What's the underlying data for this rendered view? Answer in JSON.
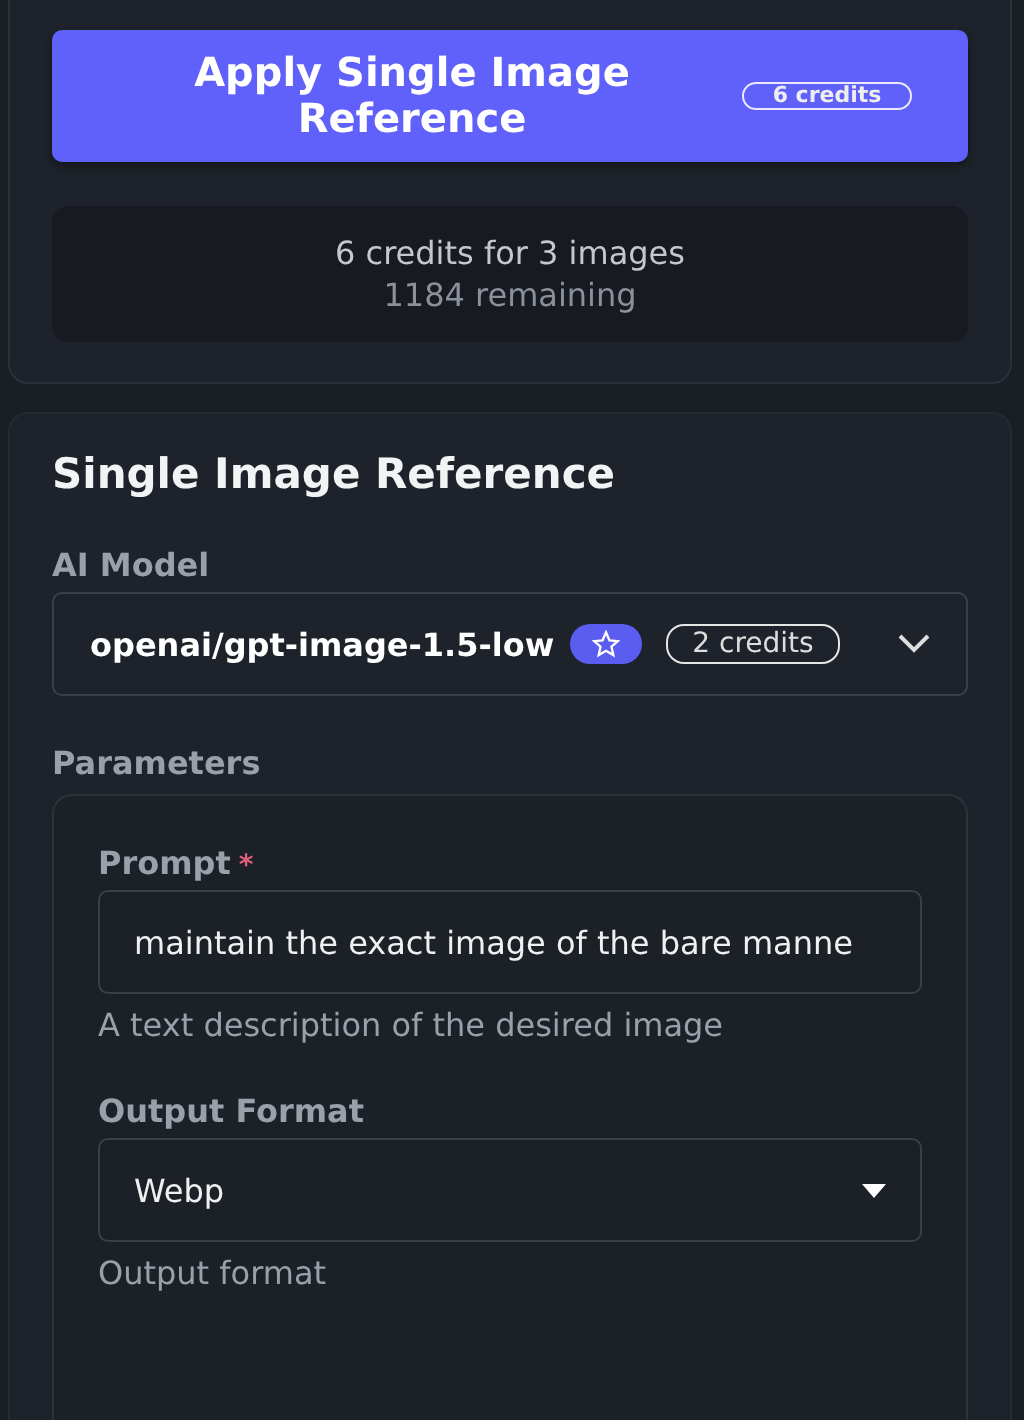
{
  "apply_button": {
    "label": "Apply Single Image Reference",
    "credits_badge": "6 credits"
  },
  "cost_summary": {
    "line_1": "6 credits for 3 images",
    "line_2": "1184 remaining"
  },
  "section": {
    "title": "Single Image Reference",
    "model": {
      "label": "AI Model",
      "value": "openai/gpt-image-1.5-low",
      "credits": "2 credits",
      "starred": true
    },
    "parameters": {
      "label": "Parameters",
      "fields": [
        {
          "kind": "text",
          "label": "Prompt",
          "required_mark": "*",
          "value": "maintain the exact image of the bare manne",
          "help": "A text description of the desired image"
        },
        {
          "kind": "select",
          "label": "Output Format",
          "value": "Webp",
          "help": "Output format"
        }
      ]
    }
  }
}
